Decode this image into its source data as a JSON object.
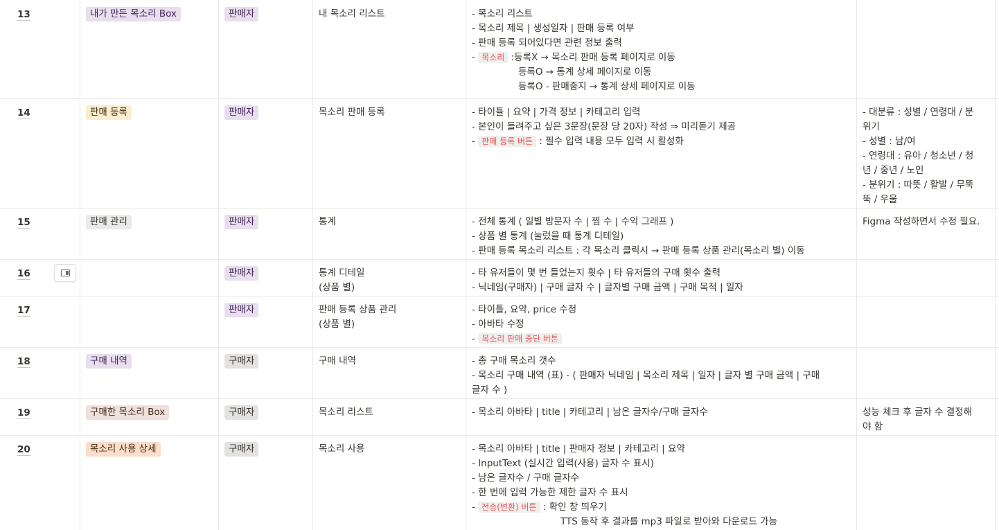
{
  "rows": [
    {
      "num": "13",
      "category": "내가 만든 목소리 Box",
      "role": "판매자",
      "page": "내 목소리 리스트",
      "desc": [
        "- 목소리 리스트",
        "- 목소리 제목 | 생성일자 | 판매 등록 여부",
        "- 판매 등록 되어있다면 관련 정보 출력"
      ],
      "desc_code_prefix": "- ",
      "desc_code": "목소리",
      "desc_code_suffix": " :등록X → 목소리 판매 등록 페이지로 이동",
      "desc_after": [
        "등록O → 통계 상세 페이지로 이동",
        "등록O - 판매중지 → 통계 상세 페이지로 이동"
      ],
      "note": ""
    },
    {
      "num": "14",
      "category": "판매 등록",
      "role": "판매자",
      "page": "목소리 판매 등록",
      "desc": [
        "- 타이틀 | 요약 | 가격 정보 | 카테고리 입력",
        "- 본인이 들려주고 싶은 3문장(문장 당 20자) 작성 ⇒ 미리듣기  제공"
      ],
      "desc_code_prefix": "- ",
      "desc_code": "판매 등록 버튼",
      "desc_code_suffix": " : 필수 입력 내용 모두 입력 시 활성화",
      "note": [
        "- 대분류 : 성별 / 연령대 / 분",
        "위기",
        "- 성별 : 남/여",
        "- 연령대 : 유아 / 청소년 / 청",
        "년 / 중년 / 노인",
        "- 분위기 : 따뜻 / 활발 / 무뚝",
        "뚝 / 우울"
      ]
    },
    {
      "num": "15",
      "category": "판매 관리",
      "role": "판매자",
      "page": "통계",
      "desc": [
        "- 전체 통계 ( 일별 방문자 수 | 찜 수 | 수익 그래프 )",
        "- 상품 별 통계 (눌렀을 때 통계 디테일)",
        "- 판매 등록 목소리 리스트 : 각 목소리 클릭시 → 판매 등록 상품 관리(목소리 별) 이동"
      ],
      "note": "Figma 작성하면서 수정 필요."
    },
    {
      "num": "16",
      "category": "",
      "role": "판매자",
      "page": [
        "통계 디테일",
        "(상품 별)"
      ],
      "desc": [
        "- 타 유저들이 몇 번 들었는지 횟수 | 타 유저들의 구매 횟수 출력",
        "- 닉네임(구매자) | 구매 글자 수 | 글자별 구매 금액 | 구매 목적 | 일자"
      ],
      "note": ""
    },
    {
      "num": "17",
      "category": "",
      "role": "판매자",
      "page": [
        "판매 등록 상품 관리",
        "(상품 별)"
      ],
      "desc": [
        "- 타이틀, 요약, price 수정",
        "- 아바타 수정"
      ],
      "desc_code_prefix": "- ",
      "desc_code": "목소리 판매 중단 버튼",
      "desc_code_suffix": "",
      "note": ""
    },
    {
      "num": "18",
      "category": "구매 내역",
      "role": "구매자",
      "page": "구매 내역",
      "desc": [
        "- 총 구매 목소리 갯수",
        "- 목소리 구매 내역 (표) - ( 판매자 닉네임 | 목소리 제목 | 일자 | 글자 별 구매 금액 | 구매",
        "글자 수 )"
      ],
      "note": ""
    },
    {
      "num": "19",
      "category": "구매한 목소리 Box",
      "role": "구매자",
      "page": "목소리 리스트",
      "desc": [
        "- 목소리 아바타 | title | 카테고리 | 남은 글자수/구매 글자수"
      ],
      "note": [
        "성능 체크 후 글자 수 결정해",
        "야 함"
      ]
    },
    {
      "num": "20",
      "category": "목소리 사용 상세",
      "role": "구매자",
      "page": "목소리 사용",
      "desc": [
        "- 목소리 아바타 | title | 판매자 정보 | 카테고리 | 요약",
        "- InputText (실시간 입력(사용) 글자 수 표시)",
        "- 남은 글자수 / 구매 글자수",
        "- 한 번에 입력 가능한 제한 글자 수 표시"
      ],
      "desc_code_prefix": "- ",
      "desc_code": "전송(변환) 버튼",
      "desc_code_suffix": " :  확인 창 띄우기",
      "desc_after": [
        "TTS 동작 후 결과를 mp3 파일로 받아와 다운로드 가능"
      ],
      "note": ""
    }
  ],
  "icons": {
    "peek": "open-as-page-icon"
  },
  "colors": {
    "border": "#e9e9e7",
    "code_text": "#eb5757",
    "code_bg": "#f0efed"
  }
}
